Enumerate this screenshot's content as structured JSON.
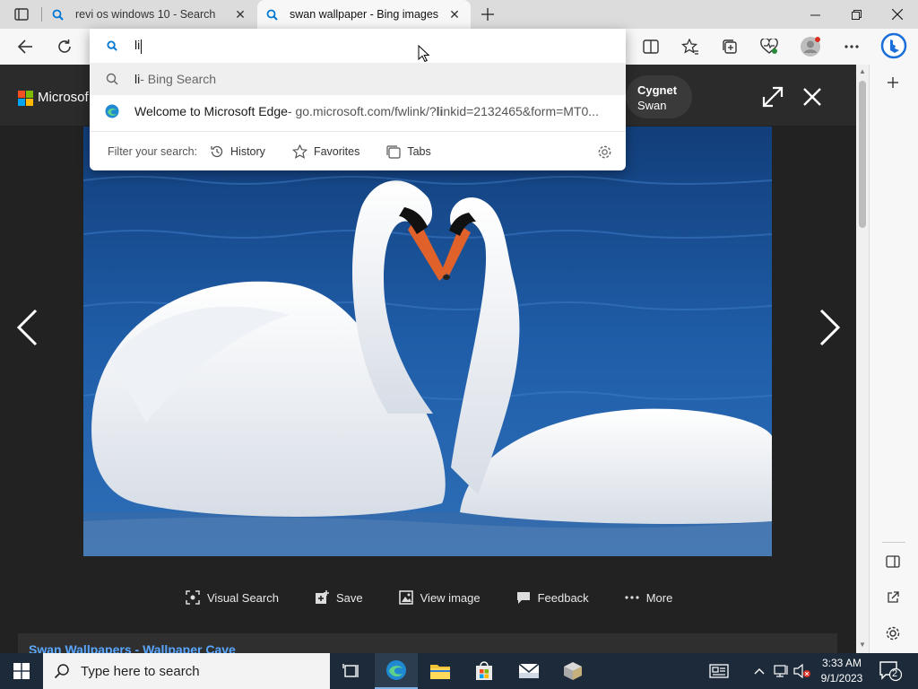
{
  "tabs": [
    {
      "label": "revi os windows 10 - Search",
      "icon": "search-icon",
      "active": false
    },
    {
      "label": "swan wallpaper - Bing images",
      "icon": "search-icon",
      "active": true
    }
  ],
  "address": {
    "typed": "li",
    "suggestions": [
      {
        "bold": "li",
        "suffix": " - Bing Search",
        "icon": "search-icon"
      },
      {
        "title": "Welcome to Microsoft Edge",
        "url_pre": " - go.microsoft.com/fwlink/?",
        "url_bold": "li",
        "url_post": "nkid=2132465&form=MT0...",
        "icon": "edge-icon"
      }
    ],
    "filter_label": "Filter your search:",
    "filters": [
      "History",
      "Favorites",
      "Tabs"
    ]
  },
  "viewer": {
    "brand": "Microsof",
    "related": {
      "line1": "Cygnet",
      "line2": "Swan"
    },
    "actions": [
      "Visual Search",
      "Save",
      "View image",
      "Feedback",
      "More"
    ],
    "footer_link": "Swan Wallpapers - Wallpaper Cave"
  },
  "taskbar": {
    "search_placeholder": "Type here to search",
    "time": "3:33 AM",
    "date": "9/1/2023",
    "notification_count": "2"
  },
  "colors": {
    "accent": "#0078d4",
    "link": "#5aa7ff",
    "taskbar": "#1c2a3a"
  }
}
